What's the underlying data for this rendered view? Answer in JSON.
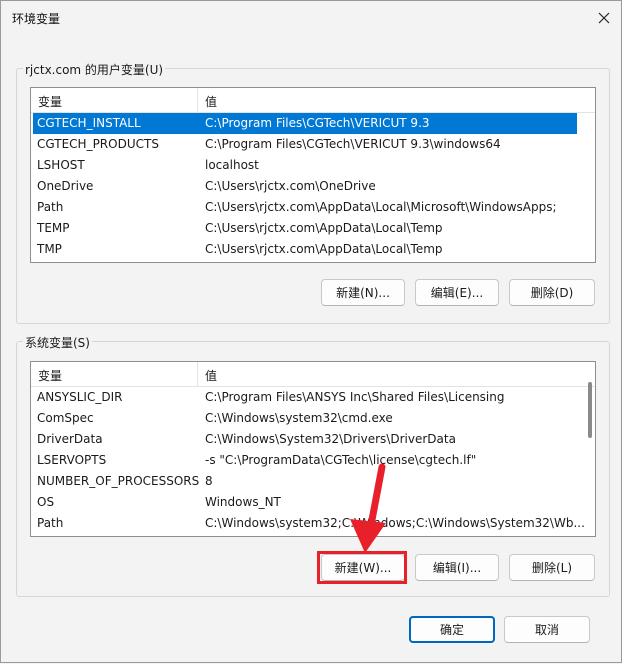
{
  "window": {
    "title": "环境变量"
  },
  "user_vars": {
    "label": "rjctx.com 的用户变量(U)",
    "col_var": "变量",
    "col_val": "值",
    "rows": [
      {
        "name": "CGTECH_INSTALL",
        "value": "C:\\Program Files\\CGTech\\VERICUT 9.3"
      },
      {
        "name": "CGTECH_PRODUCTS",
        "value": "C:\\Program Files\\CGTech\\VERICUT 9.3\\windows64"
      },
      {
        "name": "LSHOST",
        "value": "localhost"
      },
      {
        "name": "OneDrive",
        "value": "C:\\Users\\rjctx.com\\OneDrive"
      },
      {
        "name": "Path",
        "value": "C:\\Users\\rjctx.com\\AppData\\Local\\Microsoft\\WindowsApps;"
      },
      {
        "name": "TEMP",
        "value": "C:\\Users\\rjctx.com\\AppData\\Local\\Temp"
      },
      {
        "name": "TMP",
        "value": "C:\\Users\\rjctx.com\\AppData\\Local\\Temp"
      }
    ],
    "selected_row": "CGTECH_INSTALL",
    "new_btn": "新建(N)...",
    "edit_btn": "编辑(E)...",
    "delete_btn": "删除(D)"
  },
  "system_vars": {
    "label": "系统变量(S)",
    "col_var": "变量",
    "col_val": "值",
    "rows": [
      {
        "name": "ANSYSLIC_DIR",
        "value": "C:\\Program Files\\ANSYS Inc\\Shared Files\\Licensing"
      },
      {
        "name": "ComSpec",
        "value": "C:\\Windows\\system32\\cmd.exe"
      },
      {
        "name": "DriverData",
        "value": "C:\\Windows\\System32\\Drivers\\DriverData"
      },
      {
        "name": "LSERVOPTS",
        "value": "-s \"C:\\ProgramData\\CGTech\\license\\cgtech.lf\""
      },
      {
        "name": "NUMBER_OF_PROCESSORS",
        "value": "8"
      },
      {
        "name": "OS",
        "value": "Windows_NT"
      },
      {
        "name": "Path",
        "value": "C:\\Windows\\system32;C:\\Windows;C:\\Windows\\System32\\Wb..."
      }
    ],
    "new_btn": "新建(W)...",
    "edit_btn": "编辑(I)...",
    "delete_btn": "删除(L)"
  },
  "footer": {
    "ok_btn": "确定",
    "cancel_btn": "取消"
  },
  "colors": {
    "selection": "#0078d4",
    "highlight": "#e8202a",
    "primary_border": "#0067c0"
  }
}
